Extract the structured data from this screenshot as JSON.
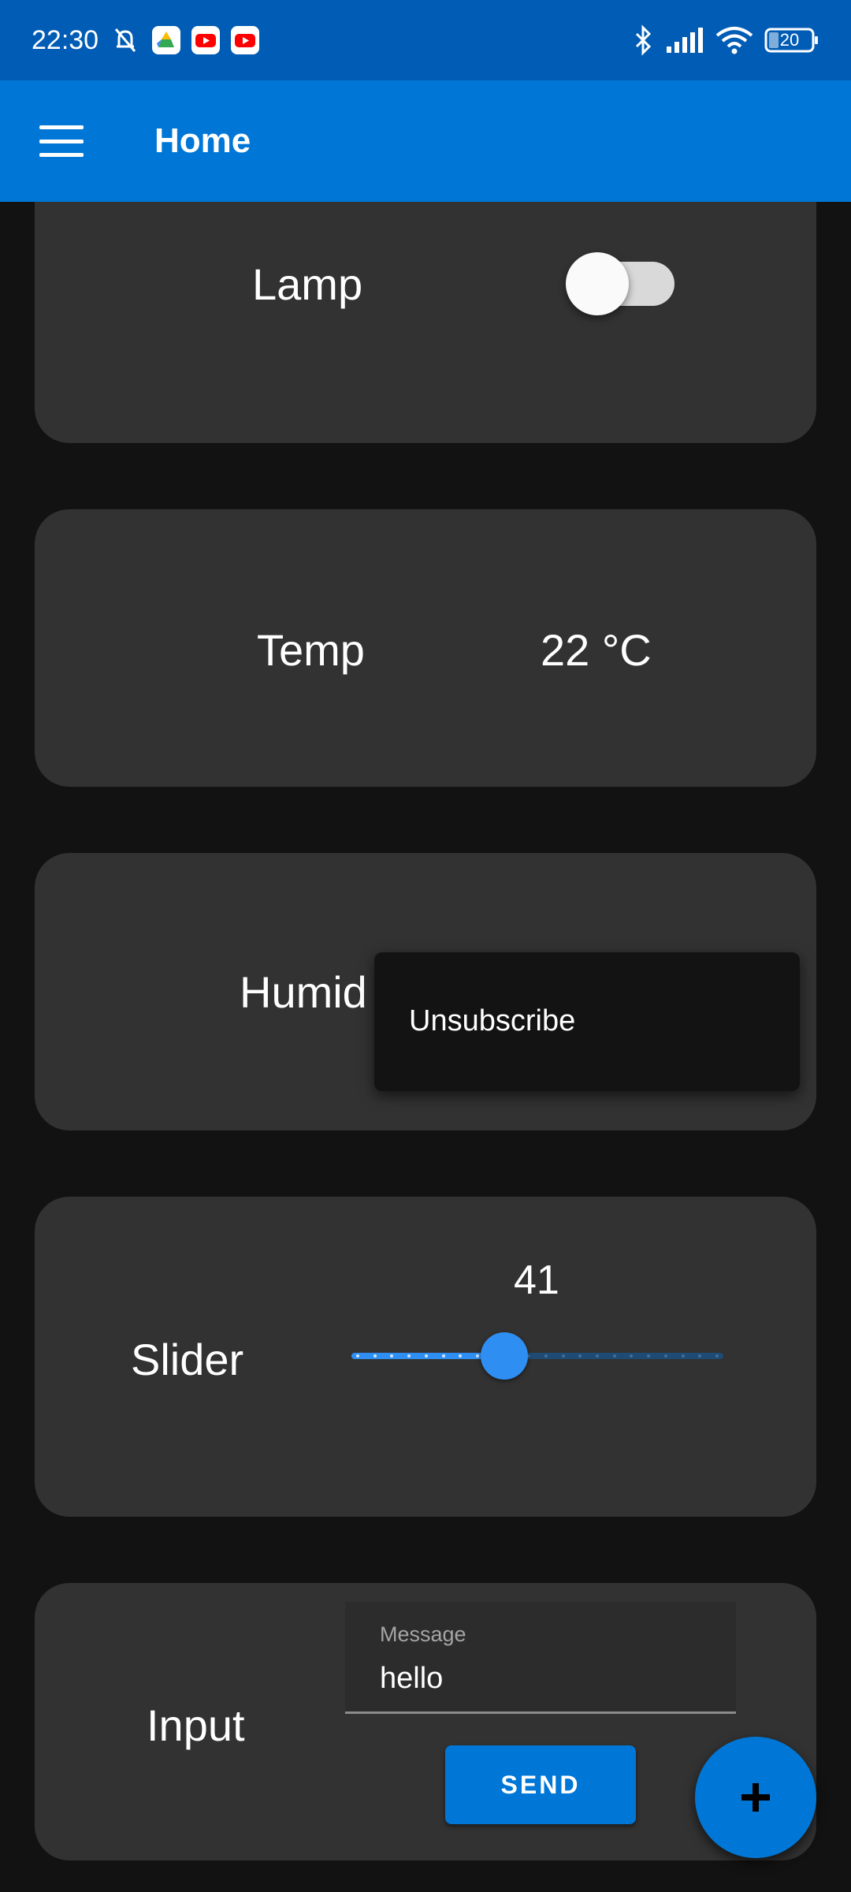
{
  "status_bar": {
    "time": "22:30",
    "icons": [
      "mute-bell-icon",
      "drive-icon",
      "youtube-icon",
      "youtube-icon",
      "bluetooth-icon",
      "signal-icon",
      "wifi-icon",
      "battery-icon"
    ],
    "battery_level": "20"
  },
  "app_bar": {
    "title": "Home",
    "menu_icon": "hamburger-menu-icon"
  },
  "cards": {
    "lamp": {
      "label": "Lamp",
      "switch_on": false
    },
    "temp": {
      "label": "Temp",
      "value": "22 °C"
    },
    "humid": {
      "label": "Humid"
    },
    "slider": {
      "label": "Slider",
      "value": "41",
      "fraction": 0.41
    },
    "input": {
      "label": "Input",
      "field_label": "Message",
      "field_value": "hello",
      "send_label": "SEND"
    }
  },
  "context_menu": {
    "items": [
      "Unsubscribe"
    ]
  },
  "fab": {
    "icon": "plus-icon"
  },
  "colors": {
    "status_bar": "#005cb4",
    "app_bar": "#0077d6",
    "accent": "#2f8ef2",
    "card": "#323232",
    "background": "#121212"
  }
}
